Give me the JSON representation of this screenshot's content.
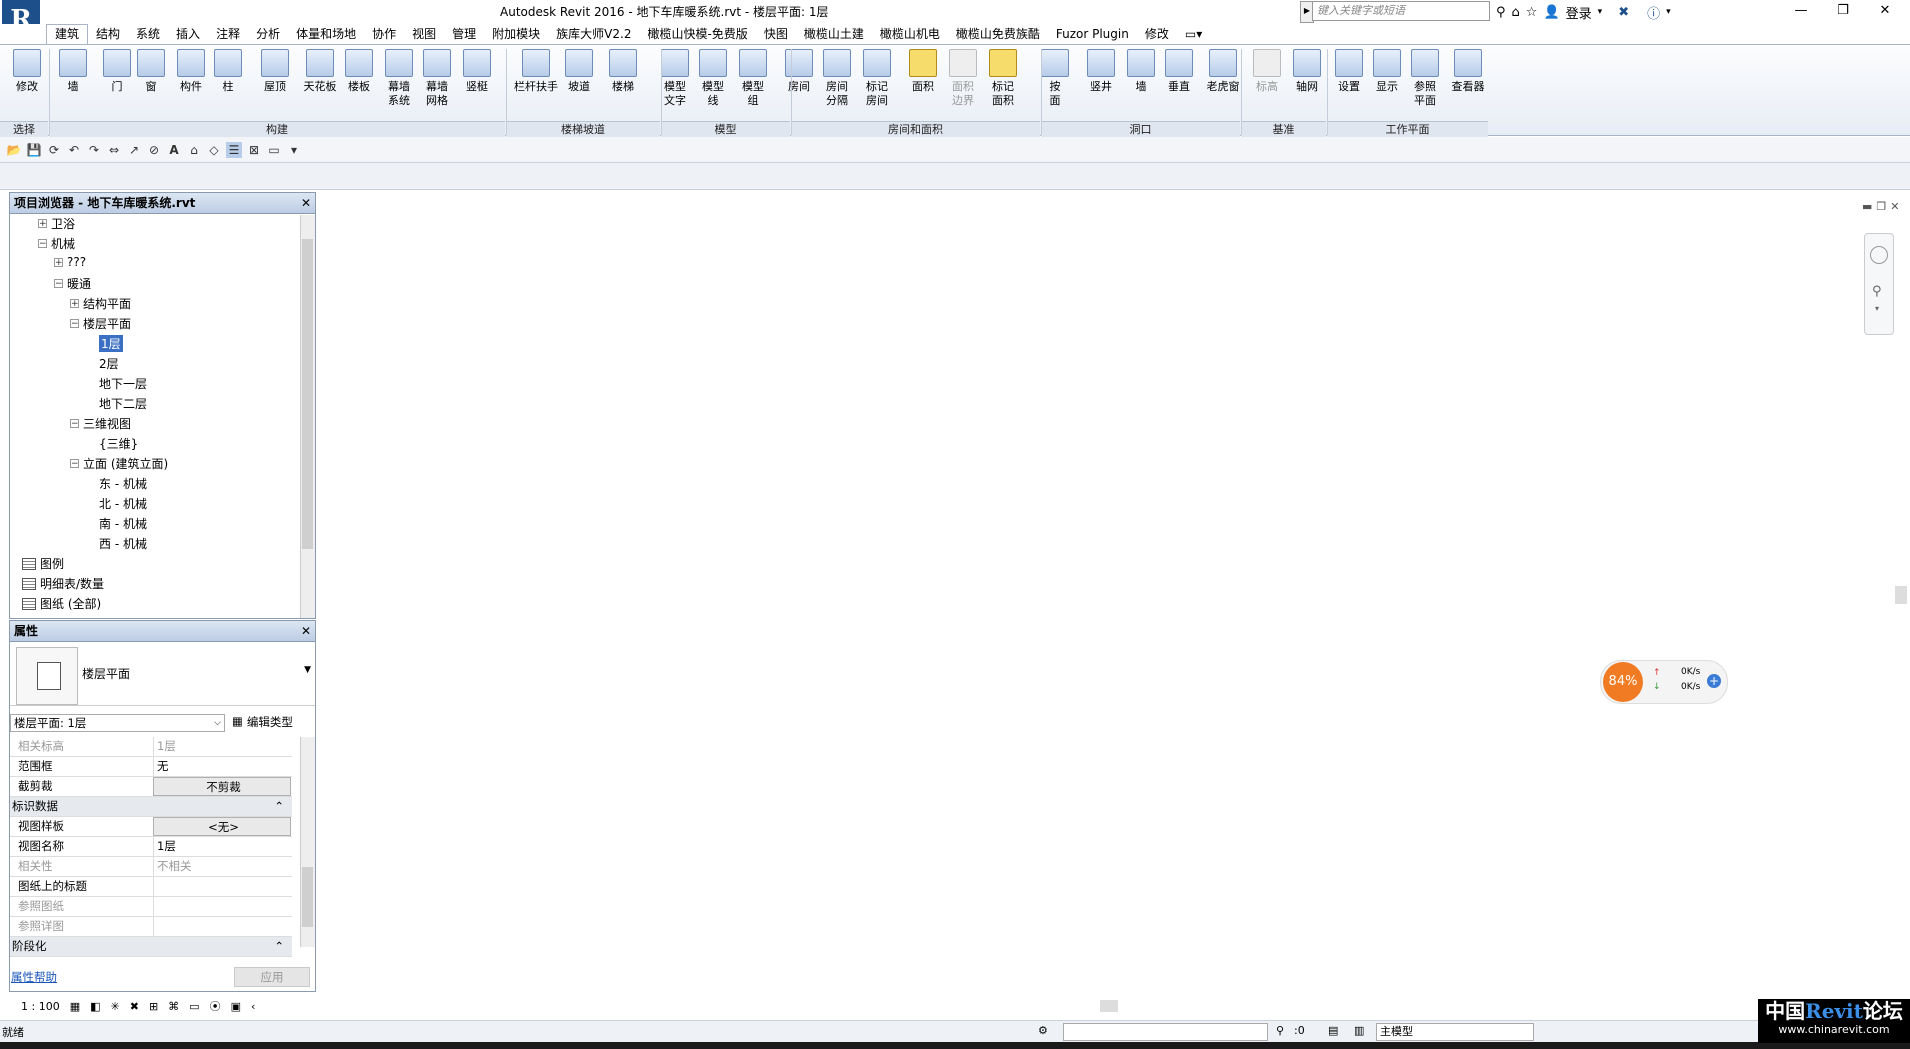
{
  "window": {
    "title": "Autodesk Revit 2016 -     地下车库暖系统.rvt - 楼层平面: 1层",
    "search_placeholder": "键入关键字或短语",
    "login": "登录",
    "app_letter": "R",
    "minimize": "—",
    "restore": "❐",
    "close": "✕"
  },
  "tabs": [
    "建筑",
    "结构",
    "系统",
    "插入",
    "注释",
    "分析",
    "体量和场地",
    "协作",
    "视图",
    "管理",
    "附加模块",
    "族库大师V2.2",
    "橄榄山快模-免费版",
    "快图",
    "橄榄山土建",
    "橄榄山机电",
    "橄榄山免费族酷",
    "Fuzor Plugin",
    "修改"
  ],
  "active_tab": "建筑",
  "ribbon": {
    "buttons": [
      {
        "label": "修改",
        "icon": "modify-cursor-icon"
      },
      {
        "label": "墙",
        "icon": "wall-icon"
      },
      {
        "label": "门",
        "icon": "door-icon"
      },
      {
        "label": "窗",
        "icon": "window-icon"
      },
      {
        "label": "构件",
        "icon": "component-icon"
      },
      {
        "label": "柱",
        "icon": "column-icon"
      },
      {
        "label": "屋顶",
        "icon": "roof-icon"
      },
      {
        "label": "天花板",
        "icon": "ceiling-icon"
      },
      {
        "label": "楼板",
        "icon": "floor-icon"
      },
      {
        "label": "幕墙\n系统",
        "icon": "curtain-system-icon"
      },
      {
        "label": "幕墙\n网格",
        "icon": "curtain-grid-icon"
      },
      {
        "label": "竖梃",
        "icon": "mullion-icon"
      },
      {
        "label": "栏杆扶手",
        "icon": "railing-icon"
      },
      {
        "label": "坡道",
        "icon": "ramp-icon"
      },
      {
        "label": "楼梯",
        "icon": "stair-icon"
      },
      {
        "label": "模型\n文字",
        "icon": "model-text-icon"
      },
      {
        "label": "模型\n线",
        "icon": "model-line-icon"
      },
      {
        "label": "模型\n组",
        "icon": "model-group-icon"
      },
      {
        "label": "房间",
        "icon": "room-icon"
      },
      {
        "label": "房间\n分隔",
        "icon": "room-separator-icon"
      },
      {
        "label": "标记\n房间",
        "icon": "tag-room-icon"
      },
      {
        "label": "面积",
        "icon": "area-icon"
      },
      {
        "label": "面积\n边界",
        "icon": "area-boundary-icon"
      },
      {
        "label": "标记\n面积",
        "icon": "tag-area-icon"
      },
      {
        "label": "按\n面",
        "icon": "opening-by-face-icon"
      },
      {
        "label": "竖井",
        "icon": "shaft-icon"
      },
      {
        "label": "墙",
        "icon": "wall-opening-icon"
      },
      {
        "label": "垂直",
        "icon": "vertical-opening-icon"
      },
      {
        "label": "老虎窗",
        "icon": "dormer-icon"
      },
      {
        "label": "标高",
        "icon": "level-icon"
      },
      {
        "label": "轴网",
        "icon": "grid-icon"
      },
      {
        "label": "设置",
        "icon": "set-workplane-icon"
      },
      {
        "label": "显示",
        "icon": "show-workplane-icon"
      },
      {
        "label": "参照\n平面",
        "icon": "ref-plane-icon"
      },
      {
        "label": "查看器",
        "icon": "viewer-icon"
      }
    ],
    "panels": [
      "选择",
      "构建",
      "楼梯坡道",
      "模型",
      "房间和面积",
      "洞口",
      "基准",
      "工作平面"
    ]
  },
  "project_browser": {
    "title": "项目浏览器 - 地下车库暖系统.rvt",
    "close": "✕",
    "items": [
      {
        "text": "卫浴",
        "pm": "+"
      },
      {
        "text": "机械",
        "pm": "−"
      },
      {
        "text": "???",
        "pm": "+"
      },
      {
        "text": "暖通",
        "pm": "−"
      },
      {
        "text": "结构平面",
        "pm": "+"
      },
      {
        "text": "楼层平面",
        "pm": "−"
      },
      {
        "text": "1层",
        "pm": ""
      },
      {
        "text": "2层",
        "pm": ""
      },
      {
        "text": "地下一层",
        "pm": ""
      },
      {
        "text": "地下二层",
        "pm": ""
      },
      {
        "text": "三维视图",
        "pm": "−"
      },
      {
        "text": "{三维}",
        "pm": ""
      },
      {
        "text": "立面 (建筑立面)",
        "pm": "−"
      },
      {
        "text": "东 - 机械",
        "pm": ""
      },
      {
        "text": "北 - 机械",
        "pm": ""
      },
      {
        "text": "南 - 机械",
        "pm": ""
      },
      {
        "text": "西 - 机械",
        "pm": ""
      },
      {
        "text": "图例",
        "pm": ""
      },
      {
        "text": "明细表/数量",
        "pm": ""
      },
      {
        "text": "图纸 (全部)",
        "pm": ""
      }
    ]
  },
  "properties": {
    "title": "属性",
    "close": "✕",
    "type_name": "楼层平面",
    "selector": "楼层平面: 1层",
    "edit_type": "编辑类型",
    "rows": [
      {
        "k": "相关标高",
        "v": "1层",
        "grp": false,
        "gray": true
      },
      {
        "k": "范围框",
        "v": "无",
        "grp": false,
        "gray": false
      },
      {
        "k": "截剪裁",
        "v": "不剪裁",
        "grp": false,
        "gray": false,
        "btn": true
      },
      {
        "k": "标识数据",
        "v": "",
        "grp": true
      },
      {
        "k": "视图样板",
        "v": "<无>",
        "grp": false,
        "gray": false,
        "btn": true
      },
      {
        "k": "视图名称",
        "v": "1层",
        "grp": false,
        "gray": false
      },
      {
        "k": "相关性",
        "v": "不相关",
        "grp": false,
        "gray": true
      },
      {
        "k": "图纸上的标题",
        "v": "",
        "grp": false,
        "gray": false
      },
      {
        "k": "参照图纸",
        "v": "",
        "grp": false,
        "gray": true
      },
      {
        "k": "参照详图",
        "v": "",
        "grp": false,
        "gray": true
      },
      {
        "k": "阶段化",
        "v": "",
        "grp": true
      }
    ],
    "help": "属性帮助",
    "apply": "应用"
  },
  "view_control": {
    "scale": "1 : 100"
  },
  "speed": {
    "percent": "84%",
    "up": "0K/s",
    "down": "0K/s"
  },
  "status": {
    "text": "就绪",
    "coord": ":0",
    "model": "主模型"
  },
  "watermark": {
    "line1a": "中国",
    "line1b": "Revit",
    "line1c": "论坛",
    "line2": "www.chinarevit.com"
  }
}
